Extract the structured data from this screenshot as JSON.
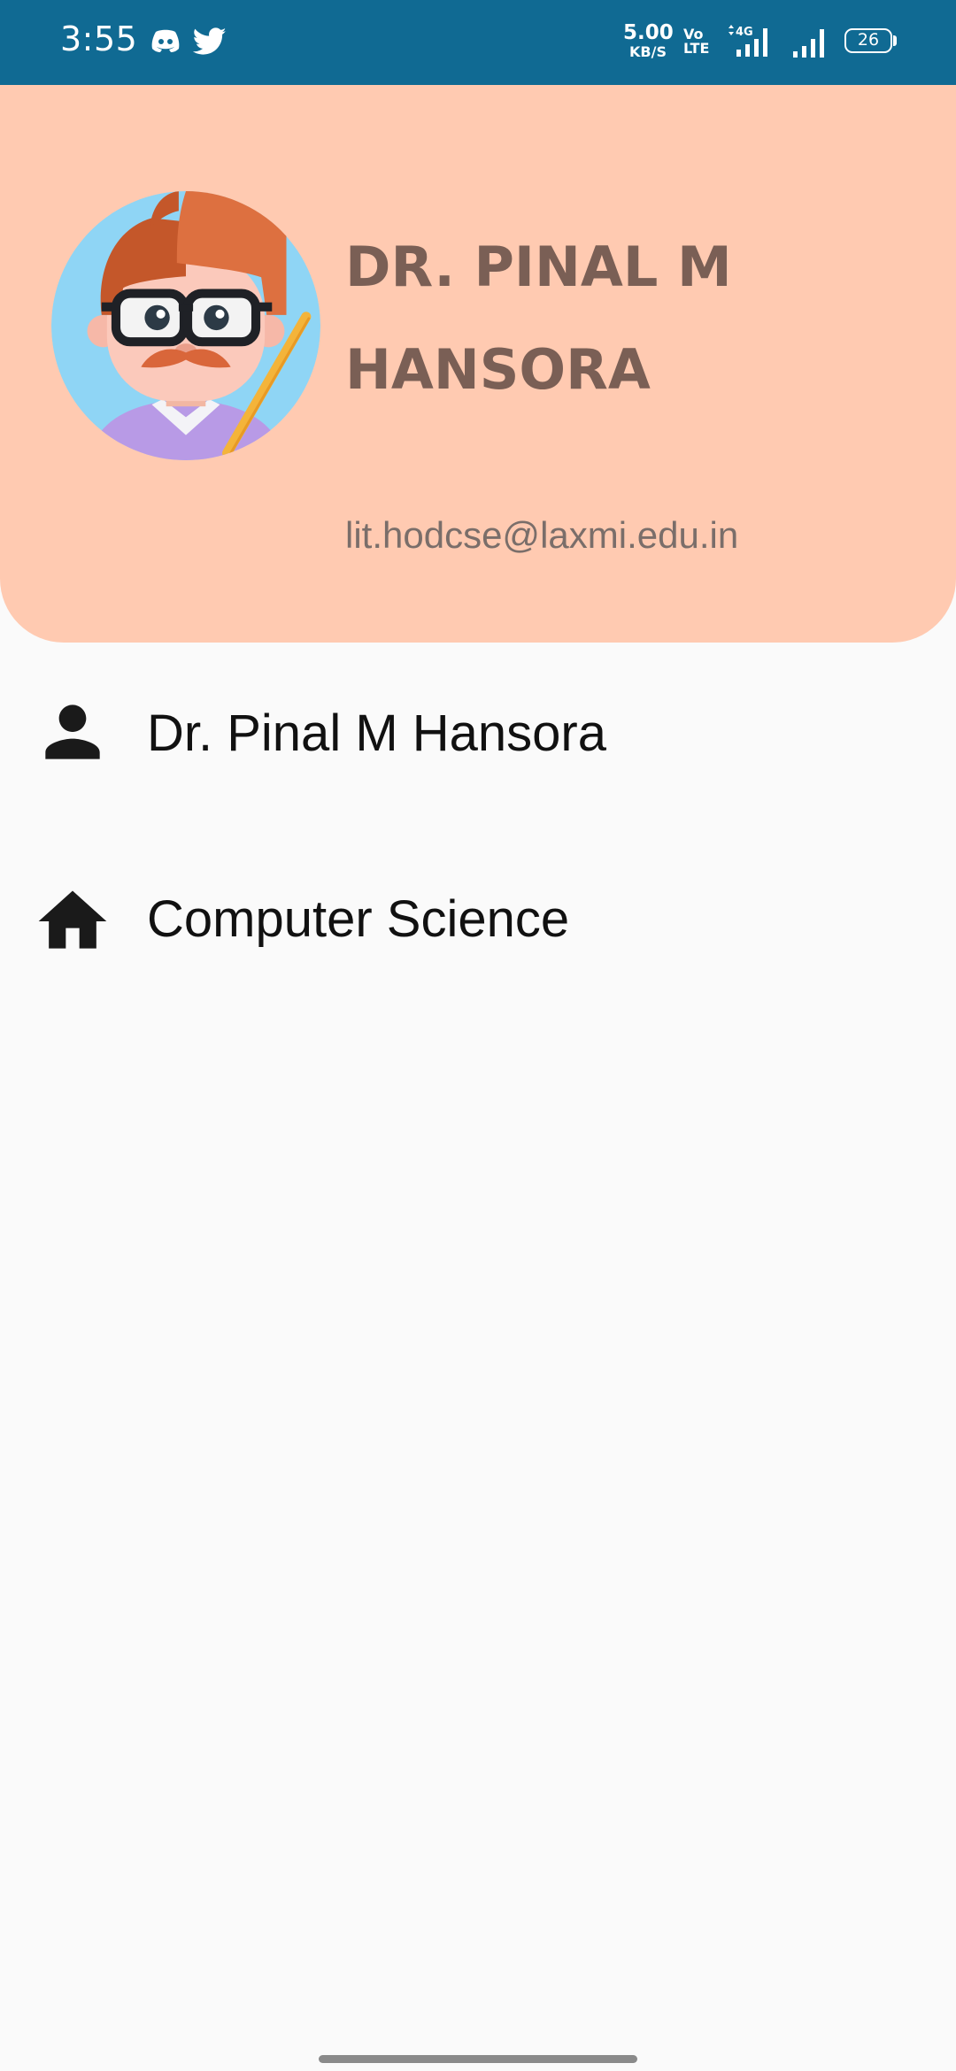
{
  "status_bar": {
    "time": "3:55",
    "net_speed_value": "5.00",
    "net_speed_unit": "KB/S",
    "volte_top": "Vo",
    "volte_bottom": "LTE",
    "network_type": "4G",
    "battery_level": "26",
    "icons": [
      "discord-icon",
      "twitter-icon",
      "signal-4g-icon",
      "signal-icon",
      "battery-icon"
    ]
  },
  "profile": {
    "name": "DR. PINAL M HANSORA",
    "email": "lit.hodcse@laxmi.edu.in",
    "avatar_icon": "teacher-avatar-icon"
  },
  "details": [
    {
      "icon": "person-icon",
      "label": "Dr. Pinal M Hansora"
    },
    {
      "icon": "home-icon",
      "label": "Computer Science"
    }
  ],
  "colors": {
    "status_bar": "#106a93",
    "header": "#ffcab1",
    "name_text": "#7a5f55",
    "background": "#fafafa"
  }
}
